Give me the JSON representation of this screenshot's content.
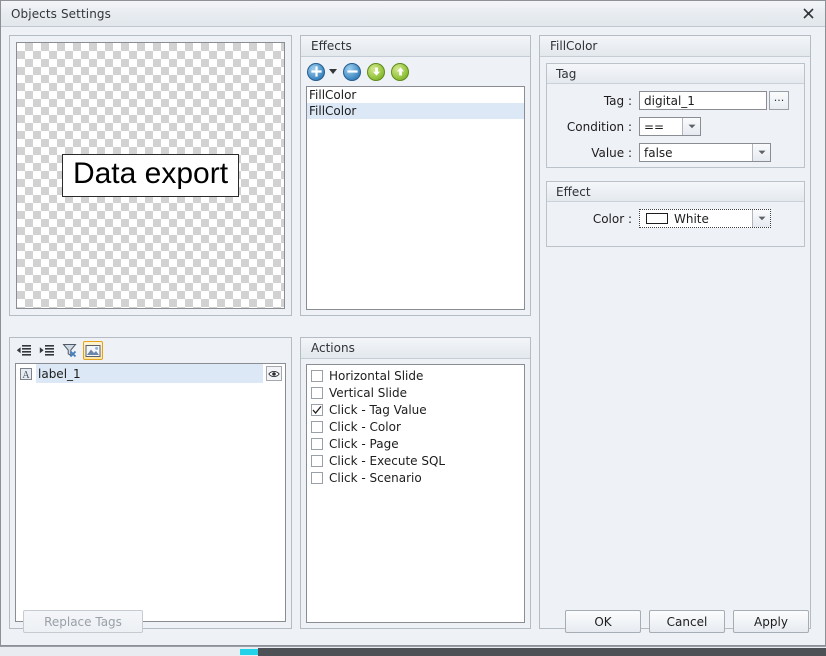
{
  "window": {
    "title": "Objects Settings",
    "close_icon": "close-icon",
    "close_glyph": "⌧"
  },
  "preview": {
    "object_label": "Data export"
  },
  "objects_panel": {
    "toolbar": [
      {
        "name": "outdent-icon",
        "tooltip": "Outdent",
        "active": false
      },
      {
        "name": "indent-icon",
        "tooltip": "Indent",
        "active": false
      },
      {
        "name": "filter-clear-icon",
        "tooltip": "Clear Filter",
        "active": false
      },
      {
        "name": "image-icon",
        "tooltip": "Image",
        "active": true
      }
    ],
    "rows": [
      {
        "icon": "text-label-icon",
        "icon_glyph": "A",
        "name": "label_1",
        "eye_icon": "eye-icon"
      }
    ],
    "replace_tags_label": "Replace Tags",
    "replace_tags_enabled": false
  },
  "effects": {
    "header": "Effects",
    "toolbar": [
      {
        "name": "add-effect-button",
        "glyph": "+",
        "color": "blue",
        "has_dropdown": true
      },
      {
        "name": "remove-effect-button",
        "glyph": "−",
        "color": "blue",
        "has_dropdown": false
      },
      {
        "name": "move-down-button",
        "glyph": "↓",
        "color": "green",
        "has_dropdown": false
      },
      {
        "name": "move-up-button",
        "glyph": "↑",
        "color": "green",
        "has_dropdown": false
      }
    ],
    "items": [
      {
        "label": "FillColor",
        "selected": false
      },
      {
        "label": "FillColor",
        "selected": true
      }
    ]
  },
  "actions": {
    "header": "Actions",
    "items": [
      {
        "label": "Horizontal Slide",
        "checked": false
      },
      {
        "label": "Vertical Slide",
        "checked": false
      },
      {
        "label": "Click - Tag Value",
        "checked": true
      },
      {
        "label": "Click - Color",
        "checked": false
      },
      {
        "label": "Click - Page",
        "checked": false
      },
      {
        "label": "Click - Execute SQL",
        "checked": false
      },
      {
        "label": "Click - Scenario",
        "checked": false
      }
    ]
  },
  "settings": {
    "header": "FillColor",
    "tag_group": {
      "header": "Tag",
      "tag_label": "Tag :",
      "tag_value": "digital_1",
      "browse_label": "···",
      "condition_label": "Condition :",
      "condition_value": "==",
      "value_label": "Value :",
      "value_value": "false"
    },
    "effect_group": {
      "header": "Effect",
      "color_label": "Color :",
      "color_value": "White",
      "color_hex": "#ffffff"
    }
  },
  "dialog_buttons": {
    "ok": "OK",
    "cancel": "Cancel",
    "apply": "Apply"
  },
  "taskbar": {
    "accent_hex": "#21d2e8"
  }
}
